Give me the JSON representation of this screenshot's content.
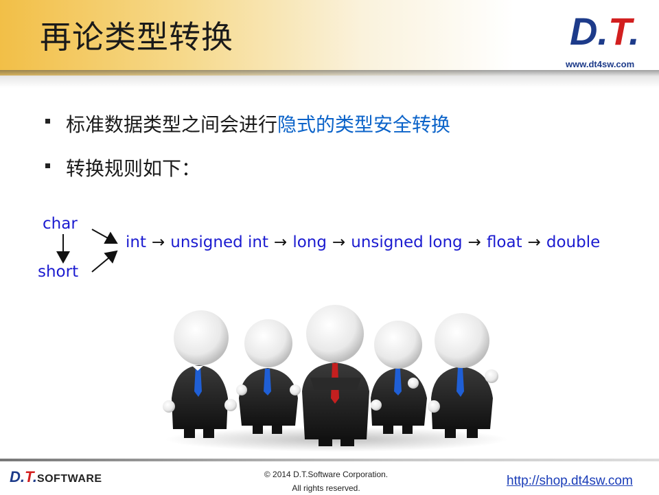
{
  "header": {
    "title": "再论类型转换",
    "logo_text": "D.T.",
    "site": "www.dt4sw.com"
  },
  "bullets": [
    {
      "text_plain": "标准数据类型之间会进行",
      "text_highlight": "隐式的类型安全转换"
    },
    {
      "text_plain": "转换规则如下：",
      "text_highlight": ""
    }
  ],
  "diagram": {
    "sources": [
      "char",
      "short"
    ],
    "chain": [
      "int",
      "unsigned int",
      "long",
      "unsigned long",
      "float",
      "double"
    ],
    "arrow_glyph": "→"
  },
  "image": {
    "icon": "businessmen-group-illustration"
  },
  "footer": {
    "logo_text": "D.T.",
    "logo_suffix": "Software",
    "copyright_line1": "© 2014 D.T.Software Corporation.",
    "copyright_line2": "All rights reserved.",
    "link": "http://shop.dt4sw.com"
  },
  "colors": {
    "accent": "#f2bf47",
    "code_blue": "#1b1bd0",
    "highlight_blue": "#0b63c9",
    "brand_navy": "#1d3b8a"
  }
}
